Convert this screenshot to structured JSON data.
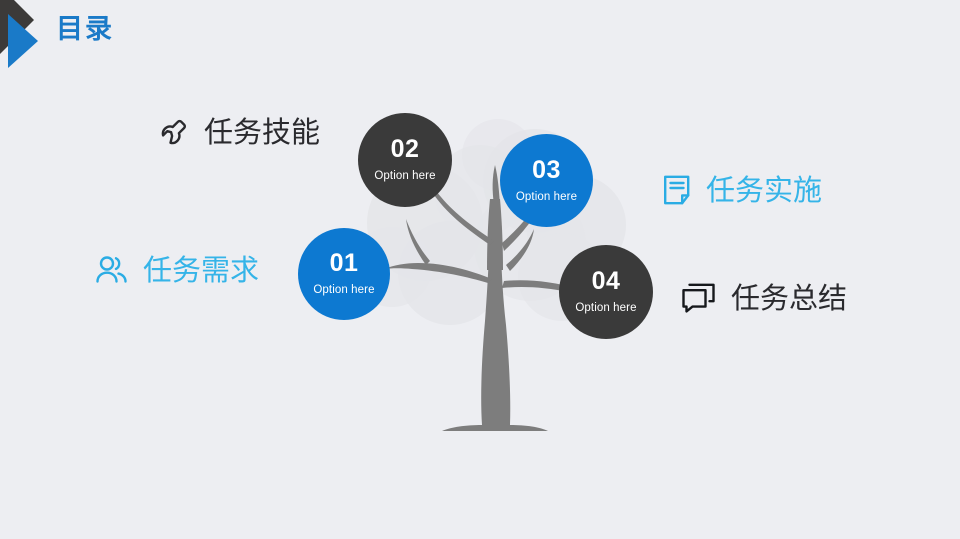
{
  "slide": {
    "background_color": "#edeef2",
    "title": "目录",
    "title_color": "#1a7ac8",
    "logo_icon": "double-arrow-logo-icon"
  },
  "theme": {
    "blue": "#0d79d1",
    "dark": "#3a3a3a",
    "light_blue": "#35b4e8",
    "tree_trunk": "#7d7d7d",
    "foliage": "#e3e4e8"
  },
  "nodes": [
    {
      "number": "01",
      "subtitle": "Option here",
      "color": "#0d79d1",
      "style": "blue"
    },
    {
      "number": "02",
      "subtitle": "Option here",
      "color": "#3a3a3a",
      "style": "dark"
    },
    {
      "number": "03",
      "subtitle": "Option here",
      "color": "#0d79d1",
      "style": "blue"
    },
    {
      "number": "04",
      "subtitle": "Option here",
      "color": "#3a3a3a",
      "style": "dark"
    }
  ],
  "labels": [
    {
      "text": "任务技能",
      "icon": "wrench-icon",
      "color": "#2a2a2e",
      "position": "top-left"
    },
    {
      "text": "任务需求",
      "icon": "users-icon",
      "color": "#35b4e8",
      "position": "mid-left"
    },
    {
      "text": "任务实施",
      "icon": "document-icon",
      "color": "#35b4e8",
      "position": "top-right"
    },
    {
      "text": "任务总结",
      "icon": "chat-icon",
      "color": "#2a2a2e",
      "position": "mid-right"
    }
  ],
  "tree": {
    "name": "decorative-tree-illustration",
    "trunk_color": "#7d7d7d",
    "foliage_color": "#e3e4e8"
  }
}
